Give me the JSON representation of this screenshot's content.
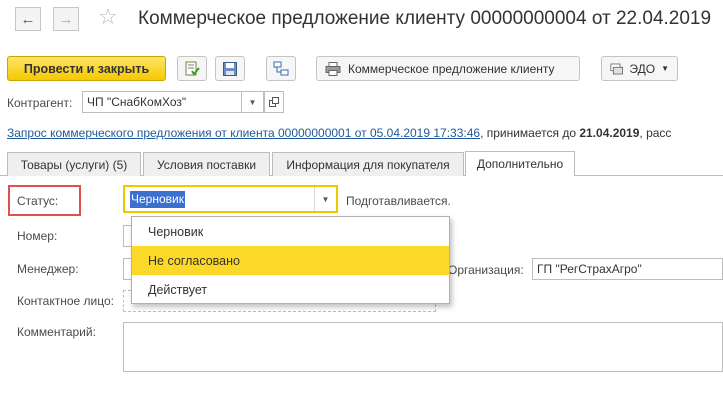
{
  "title": "Коммерческое предложение клиенту 00000000004 от 22.04.2019",
  "nav": {
    "back_icon": "arrow-left",
    "forward_icon": "arrow-right",
    "favorite_icon": "star"
  },
  "toolbar": {
    "post_close_label": "Провести и закрыть",
    "print_label": "Коммерческое предложение клиенту",
    "edo_label": "ЭДО"
  },
  "counterparty": {
    "label": "Контрагент:",
    "value": "ЧП \"СнабКомХоз\""
  },
  "request_line": {
    "link_text": "Запрос коммерческого предложения от клиента 00000000001 от 05.04.2019 17:33:46",
    "accepted_prefix": ", принимается до ",
    "accepted_date": "21.04.2019",
    "trailing": ", расс"
  },
  "tabs": [
    {
      "label": "Товары (услуги) (5)"
    },
    {
      "label": "Условия поставки"
    },
    {
      "label": "Информация для покупателя"
    },
    {
      "label": "Дополнительно"
    }
  ],
  "form": {
    "status_label": "Статус:",
    "status_value": "Черновик",
    "status_hint": "Подготавливается.",
    "number_label": "Номер:",
    "manager_label": "Менеджер:",
    "organization_label": "Организация:",
    "organization_value": "ГП \"РегСтрахАгро\"",
    "contact_label": "Контактное лицо:",
    "comment_label": "Комментарий:"
  },
  "status_options": [
    "Черновик",
    "Не согласовано",
    "Действует"
  ],
  "colors": {
    "accent": "#f5c900",
    "highlight": "#fcd928",
    "link": "#1f5a9c",
    "selection": "#3b6fd0",
    "annotation": "#e05050"
  }
}
